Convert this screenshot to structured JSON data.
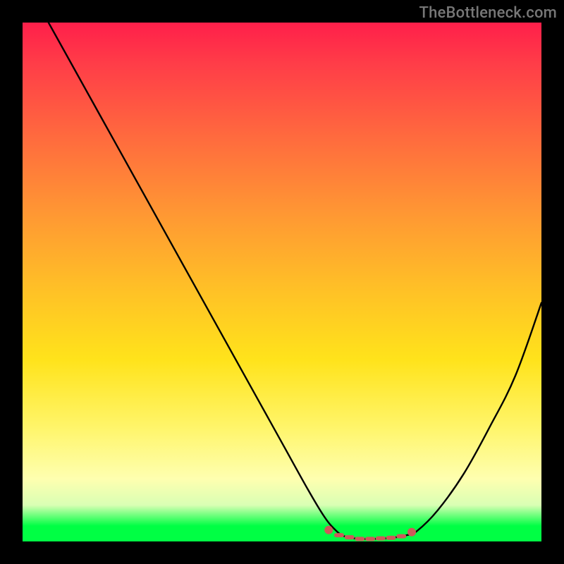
{
  "watermark": "TheBottleneck.com",
  "colors": {
    "background": "#000000",
    "gradient_top": "#ff1f4a",
    "gradient_mid1": "#ff9833",
    "gradient_mid2": "#ffe31b",
    "gradient_bottom": "#00ff44",
    "curve": "#000000",
    "markers": "#cc5a5a"
  },
  "chart_data": {
    "type": "line",
    "title": "",
    "xlabel": "",
    "ylabel": "",
    "xlim": [
      0,
      100
    ],
    "ylim": [
      0,
      100
    ],
    "grid": false,
    "note": "V-shaped bottleneck curve; y is a penalty percentage (0 = ideal). Black line is the curve; salmon markers highlight the flat near-zero trough between roughly x=60 and x=75.",
    "x": [
      5,
      10,
      15,
      20,
      25,
      30,
      35,
      40,
      45,
      50,
      55,
      58,
      60,
      62,
      65,
      68,
      70,
      72,
      74,
      76,
      80,
      85,
      90,
      95,
      100
    ],
    "y": [
      100,
      91,
      82,
      73,
      64,
      55,
      46,
      37,
      28,
      19,
      10,
      5,
      2.5,
      1,
      0.5,
      0.5,
      0.6,
      0.8,
      1.2,
      2,
      6,
      13,
      22,
      32,
      46
    ],
    "markers": {
      "x": [
        59,
        61,
        63,
        65,
        67,
        69,
        71,
        73,
        75
      ],
      "y": [
        2.2,
        1.2,
        0.8,
        0.5,
        0.5,
        0.6,
        0.7,
        1.0,
        1.8
      ]
    }
  }
}
